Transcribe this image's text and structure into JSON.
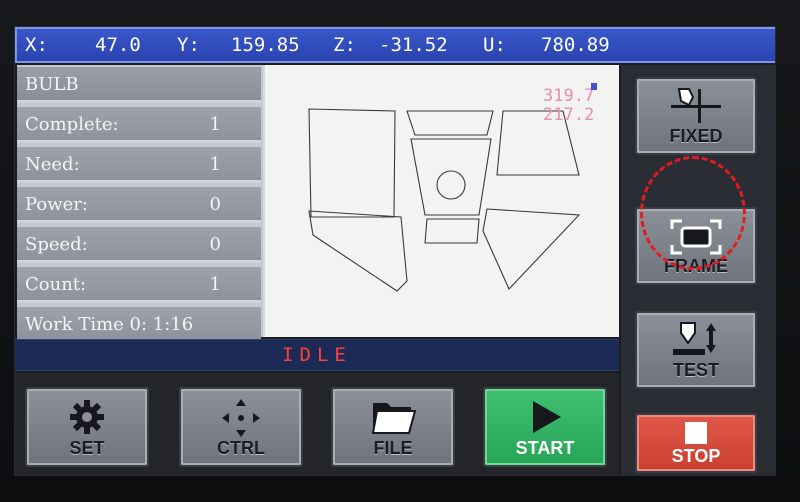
{
  "coords": {
    "x_label": "X:",
    "x_value": "47.0",
    "y_label": "Y:",
    "y_value": "159.85",
    "z_label": "Z:",
    "z_value": "-31.52",
    "u_label": "U:",
    "u_value": "780.89"
  },
  "info": {
    "file_name": "BULB",
    "rows": [
      {
        "label": "Complete:",
        "value": "1"
      },
      {
        "label": "Need:",
        "value": "1"
      },
      {
        "label": "Power:",
        "value": "0"
      },
      {
        "label": "Speed:",
        "value": "0"
      },
      {
        "label": "Count:",
        "value": "1"
      },
      {
        "label": "Work Time 0: 1:16",
        "value": ""
      }
    ]
  },
  "preview": {
    "width_dim": "319.7",
    "height_dim": "217.2"
  },
  "status": {
    "text": "IDLE",
    "color": "#ff3d3d"
  },
  "buttons": {
    "set": "SET",
    "ctrl": "CTRL",
    "file": "FILE",
    "start": "START",
    "stop": "STOP",
    "fixed": "FIXED",
    "frame": "FRAME",
    "test": "TEST"
  },
  "icons": {
    "set": "gear-icon",
    "ctrl": "direction-pad-icon",
    "file": "folder-icon",
    "start": "play-icon",
    "stop": "stop-icon",
    "fixed": "laser-head-crosshair-icon",
    "frame": "frame-corners-icon",
    "test": "laser-test-icon"
  },
  "colors": {
    "coordbar": "#2a44b0",
    "start": "#27a557",
    "stop": "#c9402f",
    "annotation": "#e11b22"
  }
}
